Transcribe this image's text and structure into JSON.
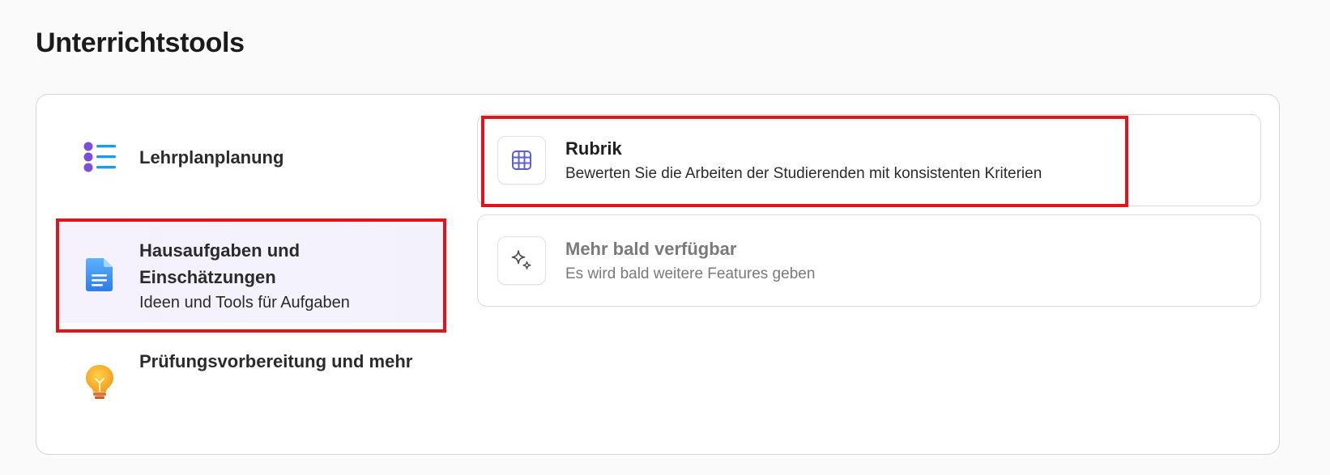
{
  "page": {
    "title": "Unterrichtstools"
  },
  "categories": [
    {
      "id": "lehrplan",
      "label": "Lehrplanplanung",
      "sub": "",
      "icon": "list-icon",
      "selected": false
    },
    {
      "id": "hausaufgaben",
      "label": "Hausaufgaben und Einschätzungen",
      "sub": "Ideen und Tools für Aufgaben",
      "icon": "document-icon",
      "selected": true
    },
    {
      "id": "pruefung",
      "label": "Prüfungsvorbereitung und mehr",
      "sub": "",
      "icon": "lightbulb-icon",
      "selected": false
    }
  ],
  "tools": [
    {
      "id": "rubrik",
      "title": "Rubrik",
      "desc": "Bewerten Sie die Arbeiten der Studierenden mit konsistenten Kriterien",
      "icon": "grid-icon"
    },
    {
      "id": "mehr",
      "title": "Mehr bald verfügbar",
      "desc": "Es wird bald weitere Features geben",
      "icon": "sparkle-icon"
    }
  ],
  "colors": {
    "highlight": "#e0141b",
    "grid_icon": "#5b5fd6",
    "list_bullets": "#7b4fd9",
    "list_lines": "#1e9be8",
    "document": "#3d8ff0",
    "bulb": "#f5a623"
  }
}
